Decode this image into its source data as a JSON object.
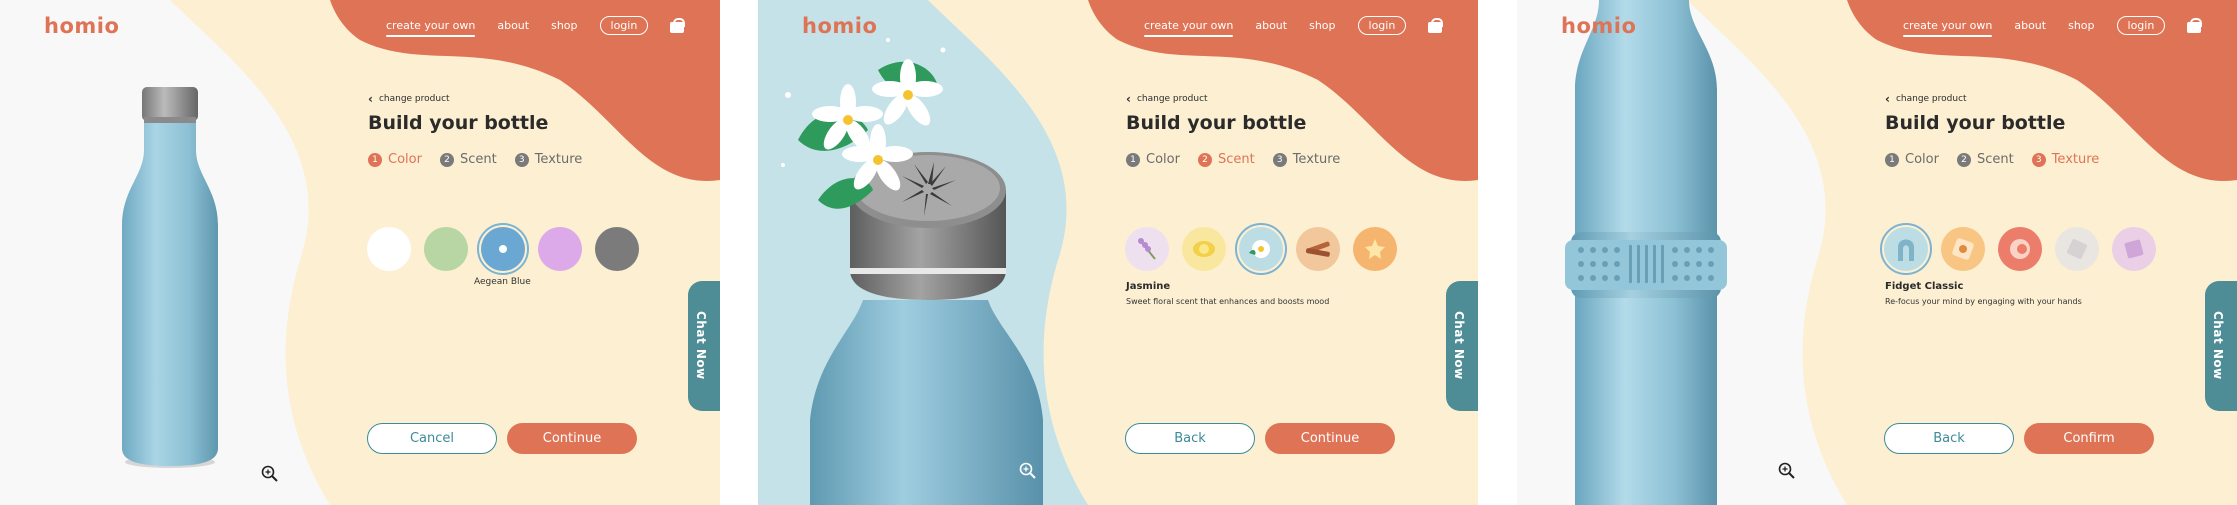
{
  "brand": "homio",
  "nav": {
    "create": "create your own",
    "about": "about",
    "shop": "shop",
    "login": "login"
  },
  "chat": "Chat Now",
  "builder": {
    "back_link": "change product",
    "title": "Build your bottle"
  },
  "steps": [
    {
      "num": "1",
      "label": "Color"
    },
    {
      "num": "2",
      "label": "Scent"
    },
    {
      "num": "3",
      "label": "Texture"
    }
  ],
  "panel1": {
    "active_step": 1,
    "swatch_colors": [
      "#ffffff",
      "#b8d5a4",
      "#6aa8d3",
      "#dcaae8",
      "#7b7b7b"
    ],
    "selected_index": 2,
    "selected_label": "Aegean Blue",
    "buttons": {
      "secondary": "Cancel",
      "primary": "Continue"
    }
  },
  "panel2": {
    "active_step": 2,
    "options": [
      "lavender",
      "lemon",
      "jasmine",
      "cinnamon",
      "vanilla"
    ],
    "selected_name": "Jasmine",
    "selected_desc": "Sweet floral scent that enhances and boosts mood",
    "buttons": {
      "secondary": "Back",
      "primary": "Continue"
    }
  },
  "panel3": {
    "active_step": 3,
    "options": [
      "fidget-classic",
      "texture-2",
      "texture-3",
      "texture-4",
      "texture-5"
    ],
    "selected_name": "Fidget Classic",
    "selected_desc": "Re-focus your mind by engaging with your hands",
    "buttons": {
      "secondary": "Back",
      "primary": "Confirm"
    }
  },
  "colors": {
    "accent": "#df7355",
    "cream": "#fdf0d2",
    "teal": "#4f8d96",
    "bottle": "#8cc0d4"
  }
}
